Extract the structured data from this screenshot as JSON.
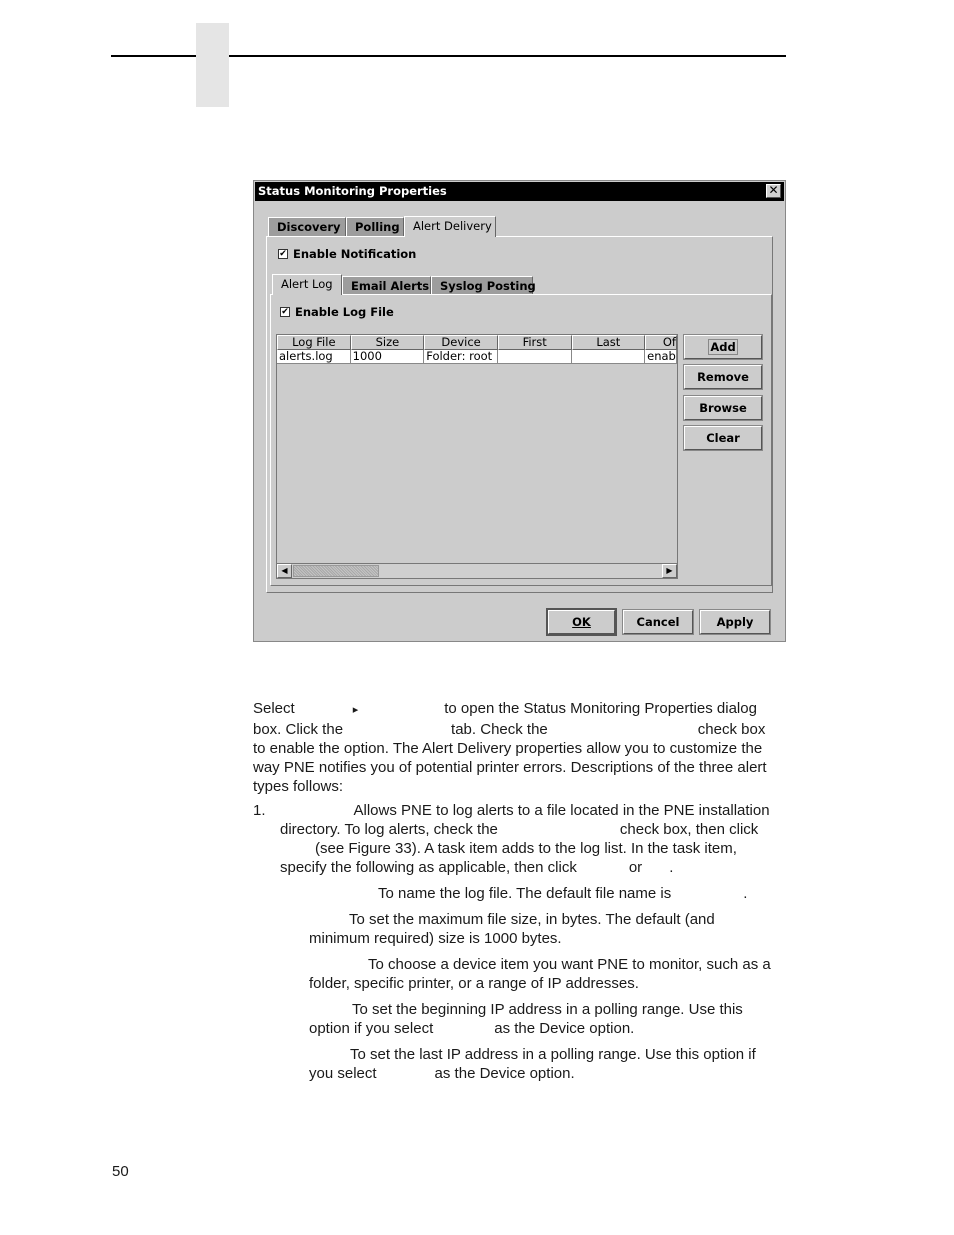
{
  "page": {
    "page_number": "50"
  },
  "dialog": {
    "title": "Status Monitoring Properties",
    "close_label": "✕",
    "tabs": [
      {
        "label": "Discovery",
        "active": false
      },
      {
        "label": "Polling",
        "active": false
      },
      {
        "label": "Alert Delivery",
        "active": true
      }
    ],
    "enable_notification": {
      "label": "Enable Notification",
      "checked": true
    },
    "sub_tabs": [
      {
        "label": "Alert Log",
        "active": true
      },
      {
        "label": "Email Alerts",
        "active": false
      },
      {
        "label": "Syslog Posting",
        "active": false
      }
    ],
    "enable_log_file": {
      "label": "Enable Log File",
      "checked": true
    },
    "table": {
      "columns": [
        "Log File",
        "Size",
        "Device",
        "First",
        "Last",
        "Of"
      ],
      "rows": [
        [
          "alerts.log",
          "1000",
          "Folder: root",
          "",
          "",
          "enabl"
        ]
      ]
    },
    "side_buttons": {
      "add": "Add",
      "remove": "Remove",
      "browse": "Browse",
      "clear": "Clear"
    },
    "bottom_buttons": {
      "ok": "OK",
      "cancel": "Cancel",
      "apply": "Apply"
    },
    "checkmark": "✔",
    "scroll_left": "◀",
    "scroll_right": "▶"
  },
  "body": {
    "intro": {
      "l1a": "Select",
      "arrow": "▸",
      "l1b": "to open the Status Monitoring Properties dialog",
      "l2a": "box. Click the",
      "l2b": "tab. Check the",
      "l2c": "check box",
      "l3": "to enable the option. The Alert Delivery properties allow you to customize the",
      "l4": "way PNE notifies you of potential printer errors. Descriptions of the three alert",
      "l5": "types follows:"
    },
    "item1": {
      "number": "1.",
      "l1": "Allows PNE to log alerts to a file located in the PNE installation",
      "l2a": "directory. To log alerts, check the",
      "l2b": "check box, then click",
      "l3": "(see Figure 33). A task item adds to the log list. In the task item,",
      "l4a": "specify the following as applicable, then click",
      "l4b": "or",
      "l4c": "."
    },
    "sub_items": {
      "log_file": {
        "l1": "To name the log file. The default file name is",
        "end": "."
      },
      "size": {
        "l1": "To set the maximum file size, in bytes. The default (and",
        "l2": "minimum required) size is 1000 bytes."
      },
      "device": {
        "l1": "To choose a device item you want PNE to monitor, such as a",
        "l2": "folder, specific printer, or a range of IP addresses."
      },
      "first": {
        "l1": "To set the beginning IP address in a polling range. Use this",
        "l2a": "option if you select",
        "l2b": "as the Device option."
      },
      "last": {
        "l1": "To set the last IP address in a polling range. Use this option if",
        "l2a": "you select",
        "l2b": "as the Device option."
      }
    }
  }
}
